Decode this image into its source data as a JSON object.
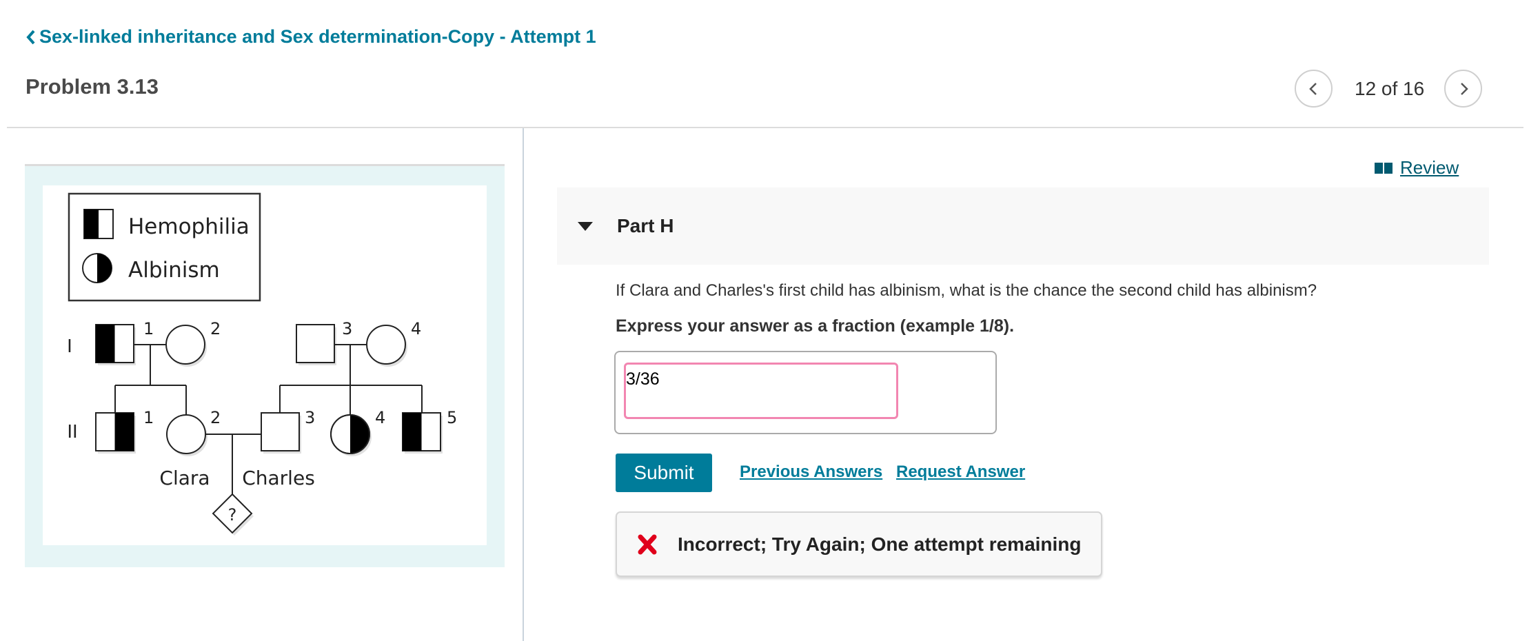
{
  "header": {
    "breadcrumb": "Sex-linked inheritance and Sex determination-Copy - Attempt 1",
    "problem_title": "Problem 3.13",
    "nav": {
      "current": 12,
      "total": 16,
      "label": "12 of 16"
    }
  },
  "figure": {
    "legend": [
      {
        "symbol": "half-filled-square",
        "label": "Hemophilia"
      },
      {
        "symbol": "half-filled-circle",
        "label": "Albinism"
      }
    ],
    "generations": [
      {
        "label": "I",
        "individuals": [
          {
            "number": "1",
            "sex": "male",
            "phenotype": "hemophilia"
          },
          {
            "number": "2",
            "sex": "female",
            "phenotype": "unaffected"
          },
          {
            "number": "3",
            "sex": "male",
            "phenotype": "unaffected"
          },
          {
            "number": "4",
            "sex": "female",
            "phenotype": "unaffected"
          }
        ]
      },
      {
        "label": "II",
        "individuals": [
          {
            "number": "1",
            "sex": "male",
            "phenotype": "hemophilia"
          },
          {
            "number": "2",
            "sex": "female",
            "phenotype": "unaffected",
            "name": "Clara"
          },
          {
            "number": "3",
            "sex": "male",
            "phenotype": "unaffected",
            "name": "Charles"
          },
          {
            "number": "4",
            "sex": "female",
            "phenotype": "albinism"
          },
          {
            "number": "5",
            "sex": "male",
            "phenotype": "hemophilia"
          }
        ]
      }
    ],
    "offspring_label": "?"
  },
  "review": {
    "label": " Review",
    "icon": "book-icon"
  },
  "part": {
    "title": "Part H",
    "question": "If Clara and Charles's first child has albinism, what is the chance the second child has albinism?",
    "instruction": "Express your answer as a fraction (example 1/8).",
    "answer_value": "3/36",
    "answer_placeholder": ""
  },
  "actions": {
    "submit": "Submit",
    "previous_answers": "Previous Answers",
    "request_answer": "Request Answer"
  },
  "feedback": {
    "status": "incorrect",
    "icon": "x-icon",
    "message": "Incorrect; Try Again; One attempt remaining"
  },
  "colors": {
    "accent": "#007c9a",
    "review_link": "#005a70",
    "input_border_incorrect": "#f286b1",
    "error_icon": "#e0001b",
    "figure_background": "#e6f5f6"
  }
}
